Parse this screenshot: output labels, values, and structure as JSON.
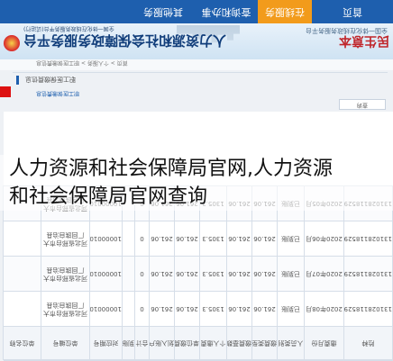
{
  "nav": {
    "items": [
      "首页",
      "在线服务",
      "查询和办事",
      "其他服务"
    ],
    "active_index": 1
  },
  "banner": {
    "left_text": "民生意本",
    "left_subtext": "全国一体化在线政务服务平台",
    "title": "人力资源和社会保障政务服务平台",
    "subtitle": "全国一体化在线政务服务平台(试运行)"
  },
  "breadcrumb": "首页 > 个人服务 > 职工医保缴费信息",
  "section": {
    "label": "职工医保缴费信息"
  },
  "pager": {
    "top_text": "职工医保缴费信息",
    "button": "查询"
  },
  "table": {
    "headers": [
      "险种",
      "缴费月份",
      "人员类别",
      "缴费类型",
      "缴费基数",
      "个人缴费",
      "单位缴费",
      "划入账户",
      "合计",
      "到账标志",
      "对应期号",
      "单位编号",
      "单位名称"
    ],
    "rows": [
      [
        "131028118529",
        "2020年08月",
        "已到账",
        "261.06",
        "261.06",
        "1305.3",
        "261.06",
        "261.06",
        "0",
        "",
        "100000104953886",
        "河北省邢台市大厂回族自治县",
        ""
      ],
      [
        "131028118529",
        "2020年07月",
        "已到账",
        "261.06",
        "261.06",
        "1305.3",
        "261.06",
        "261.06",
        "0",
        "",
        "100000103986826",
        "河北省邢台市大厂回族自治县",
        ""
      ],
      [
        "131028118529",
        "2020年06月",
        "已到账",
        "261.06",
        "261.06",
        "1305.3",
        "261.06",
        "261.06",
        "0",
        "",
        "100000101755948",
        "河北省邢台市大厂回族自治县",
        ""
      ],
      [
        "131028118529",
        "2020年05月",
        "已到账",
        "261.06",
        "261.06",
        "1305.3",
        "261.06",
        "261.06",
        "0",
        "",
        "100000100599397",
        "河北省邢台市大厂回族自治县",
        ""
      ]
    ]
  },
  "caption": {
    "line1": "人力资源和社会保障局官网,人力资源",
    "line2": "和社会保障局官网查询"
  }
}
